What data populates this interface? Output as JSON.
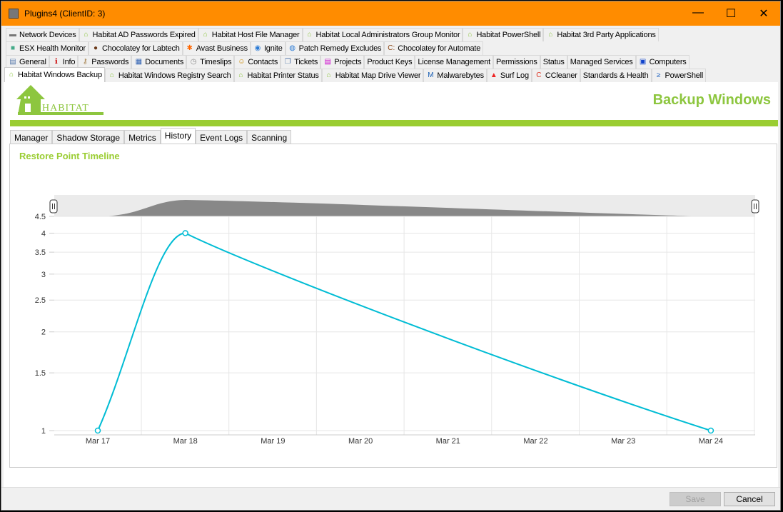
{
  "window": {
    "title": "Plugins4   (ClientID: 3)",
    "controls": [
      "—",
      "☐",
      "✕"
    ]
  },
  "tab_rows": [
    [
      {
        "label": "Network Devices",
        "icon": "network-device-icon"
      },
      {
        "label": "Habitat AD Passwords Expired",
        "icon": "habitat-house-icon"
      },
      {
        "label": "Habitat Host File Manager",
        "icon": "habitat-house-icon"
      },
      {
        "label": "Habitat Local Administrators Group Monitor",
        "icon": "habitat-house-icon"
      },
      {
        "label": "Habitat PowerShell",
        "icon": "habitat-house-icon"
      },
      {
        "label": "Habitat 3rd Party Applications",
        "icon": "habitat-house-icon"
      }
    ],
    [
      {
        "label": "ESX Health Monitor",
        "icon": "esx-icon"
      },
      {
        "label": "Chocolatey for Labtech",
        "icon": "chocolatey-icon"
      },
      {
        "label": "Avast Business",
        "icon": "avast-icon"
      },
      {
        "label": "Ignite",
        "icon": "ignite-icon"
      },
      {
        "label": "Patch Remedy Excludes",
        "icon": "patch-remedy-icon"
      },
      {
        "label": "Chocolatey for Automate",
        "icon": "chocolatey-automate-icon"
      }
    ],
    [
      {
        "label": "General",
        "icon": "general-icon"
      },
      {
        "label": "Info",
        "icon": "info-icon"
      },
      {
        "label": "Passwords",
        "icon": "keys-icon"
      },
      {
        "label": "Documents",
        "icon": "documents-icon"
      },
      {
        "label": "Timeslips",
        "icon": "clock-icon"
      },
      {
        "label": "Contacts",
        "icon": "contacts-icon"
      },
      {
        "label": "Tickets",
        "icon": "tickets-icon"
      },
      {
        "label": "Projects",
        "icon": "projects-icon"
      },
      {
        "label": "Product Keys",
        "icon": ""
      },
      {
        "label": "License Management",
        "icon": ""
      },
      {
        "label": "Permissions",
        "icon": ""
      },
      {
        "label": "Status",
        "icon": ""
      },
      {
        "label": "Managed Services",
        "icon": ""
      },
      {
        "label": "Computers",
        "icon": "computer-icon"
      }
    ],
    [
      {
        "label": "Habitat Windows Backup",
        "icon": "habitat-house-icon",
        "selected": true
      },
      {
        "label": "Habitat Windows Registry Search",
        "icon": "habitat-house-icon"
      },
      {
        "label": "Habitat Printer Status",
        "icon": "habitat-house-icon"
      },
      {
        "label": "Habitat Map Drive Viewer",
        "icon": "habitat-house-icon"
      },
      {
        "label": "Malwarebytes",
        "icon": "malwarebytes-icon"
      },
      {
        "label": "Surf Log",
        "icon": "surf-log-icon"
      },
      {
        "label": "CCleaner",
        "icon": "ccleaner-icon"
      },
      {
        "label": "Standards & Health",
        "icon": ""
      },
      {
        "label": "PowerShell",
        "icon": "powershell-icon"
      }
    ]
  ],
  "header": {
    "logo_text": "HABITAT",
    "title": "Backup Windows"
  },
  "subtabs": [
    {
      "label": "Manager"
    },
    {
      "label": "Shadow Storage"
    },
    {
      "label": "Metrics"
    },
    {
      "label": "History",
      "selected": true
    },
    {
      "label": "Event Logs"
    },
    {
      "label": "Scanning"
    }
  ],
  "chart_data": {
    "type": "line",
    "title": "Restore Point Timeline",
    "xlabel": "",
    "ylabel": "",
    "x_ticks": [
      "Mar 17",
      "Mar 18",
      "Mar 19",
      "Mar 20",
      "Mar 21",
      "Mar 22",
      "Mar 23",
      "Mar 24"
    ],
    "y_ticks": [
      1,
      1.5,
      2,
      2.5,
      3,
      3.5,
      4,
      4.5
    ],
    "y_scale": "log",
    "ylim": [
      1,
      4.5
    ],
    "grid": true,
    "navigator": true,
    "color": "#00bcd4",
    "points": [
      {
        "x": "Mar 17",
        "y": 1
      },
      {
        "x": "Mar 18",
        "y": 4
      },
      {
        "x": "Mar 24",
        "y": 1
      }
    ]
  },
  "footer": {
    "save_label": "Save",
    "cancel_label": "Cancel"
  }
}
